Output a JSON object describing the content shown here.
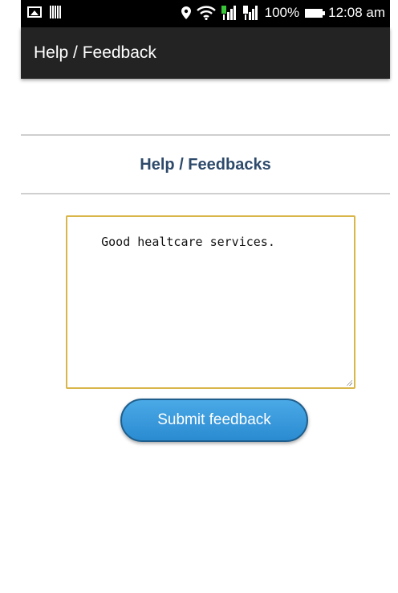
{
  "status_bar": {
    "battery_percent": "100%",
    "time": "12:08 am",
    "icons": [
      "picture-icon",
      "barcode-icon",
      "location-pin-icon",
      "wifi-icon",
      "signal-sim1-icon",
      "signal-sim2-icon",
      "battery-icon"
    ]
  },
  "app_bar": {
    "title": "Help / Feedback"
  },
  "page": {
    "heading": "Help / Feedbacks"
  },
  "feedback": {
    "value": "Good healtcare services."
  },
  "actions": {
    "submit_label": "Submit feedback"
  },
  "colors": {
    "status_bar": "#000000",
    "app_bar": "#232323",
    "heading": "#2e4a6b",
    "button": "#3a9adc",
    "textarea_border": "#d9b64a"
  }
}
